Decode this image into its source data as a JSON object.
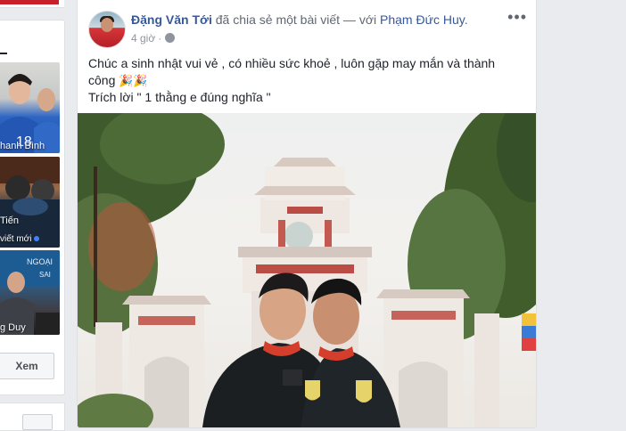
{
  "sidebar": {
    "cards": [
      {
        "caption": "hanh Bình",
        "sub": ""
      },
      {
        "caption": "Tiến",
        "sub": "viết mới"
      },
      {
        "caption": "g Duy",
        "sub": ""
      }
    ],
    "see_button": "Xem"
  },
  "post": {
    "author": "Đặng Văn Tới",
    "action": " đã chia sẻ một bài viết — với ",
    "tagged": "Phạm Đức Huy",
    "time": "4 giờ",
    "more_label": "•••",
    "line1": "Chúc a sinh nhật vui vẻ , có nhiều sức khoẻ , luôn gặp may mắn và thành công",
    "emoji": "🎉🎉",
    "line2": "Trích lời \" 1 thằng e đúng nghĩa \""
  },
  "colors": {
    "link": "#385898",
    "background": "#e9ebee",
    "card": "#ffffff"
  }
}
